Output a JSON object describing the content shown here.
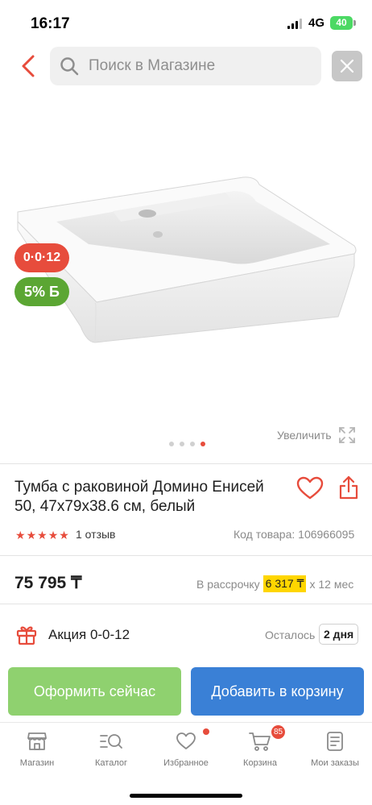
{
  "status_bar": {
    "time": "16:17",
    "network": "4G",
    "battery": "40"
  },
  "header": {
    "search_placeholder": "Поиск в Магазине"
  },
  "product": {
    "promo_badge": "0·0·12",
    "bonus_badge": "5% Б",
    "zoom_label": "Увеличить",
    "gallery": {
      "total": 4,
      "active": 4
    },
    "title": "Тумба с раковиной Домино Енисей 50, 47х79х38.6 см, белый",
    "rating": 5,
    "reviews": "1 отзыв",
    "sku": "Код товара: 106966095",
    "price": "75 795 ₸",
    "installment": {
      "prefix": "В рассрочку",
      "amount": "6 317 ₸",
      "suffix": "х 12 мес"
    },
    "promotion": {
      "label": "Акция 0-0-12",
      "remaining_label": "Осталось",
      "remaining_value": "2 дня"
    }
  },
  "actions": {
    "buy_now": "Оформить сейчас",
    "add_to_cart": "Добавить в корзину"
  },
  "nav": {
    "items": [
      {
        "label": "Магазин",
        "icon": "shop-icon"
      },
      {
        "label": "Каталог",
        "icon": "catalog-search-icon"
      },
      {
        "label": "Избранное",
        "icon": "heart-icon"
      },
      {
        "label": "Корзина",
        "icon": "cart-icon"
      },
      {
        "label": "Мои заказы",
        "icon": "orders-icon"
      }
    ],
    "cart_count": "85"
  },
  "colors": {
    "accent_red": "#e74c3c",
    "green_button": "#8fd16f",
    "blue_button": "#3a80d6",
    "bonus_green": "#5ba633",
    "installment_yellow": "#ffd600"
  }
}
